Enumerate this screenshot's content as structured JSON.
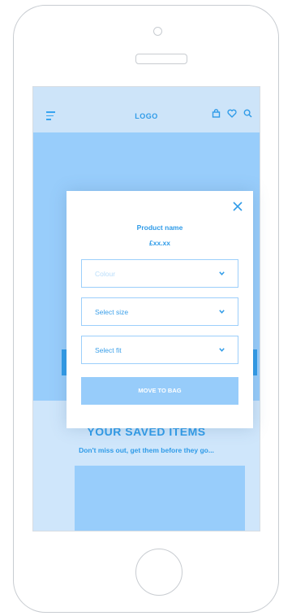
{
  "header": {
    "logo": "LOGO",
    "icons": [
      "menu-icon",
      "bag-icon",
      "heart-icon",
      "search-icon"
    ]
  },
  "saved": {
    "title": "YOUR SAVED ITEMS",
    "subtitle": "Don't miss out, get them before they go..."
  },
  "modal": {
    "product_name": "Product name",
    "price": "£xx.xx",
    "colour_placeholder": "Colour",
    "size_label": "Select size",
    "fit_label": "Select fit",
    "button_label": "MOVE TO BAG"
  },
  "colors": {
    "accent": "#2f9be8",
    "light": "#98cdfb",
    "background": "#cfe6fb"
  }
}
